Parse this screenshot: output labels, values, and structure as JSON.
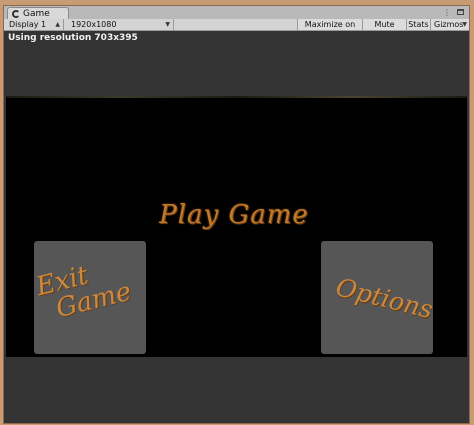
{
  "window": {
    "tab_label": "Game",
    "menu_glyph": "⋮"
  },
  "toolbar": {
    "display_select": "Display 1",
    "resolution_select": "1920x1080",
    "maximize_label": "Maximize on Play",
    "mute_label": "Mute audio",
    "stats_label": "Stats",
    "gizmos_label": "Gizmos"
  },
  "game_view": {
    "resolution_notice": "Using resolution 703x395",
    "play_button_label": "Play Game",
    "exit_button_line1": "Exit",
    "exit_button_line2": "Game",
    "options_button_label": "Options"
  },
  "colors": {
    "title_gold": "#c07a2c",
    "panel_grey": "#565656",
    "game_background": "#000000",
    "editor_background": "#343434"
  }
}
